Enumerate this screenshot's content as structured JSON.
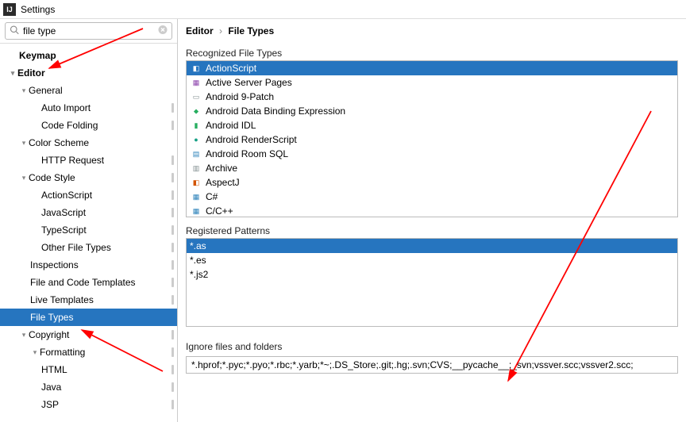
{
  "window": {
    "title": "Settings"
  },
  "search": {
    "value": "file type"
  },
  "tree": {
    "keymap": "Keymap",
    "editor": "Editor",
    "general": "General",
    "auto_import": "Auto Import",
    "code_folding": "Code Folding",
    "color_scheme": "Color Scheme",
    "http_request": "HTTP Request",
    "code_style": "Code Style",
    "actionscript": "ActionScript",
    "javascript": "JavaScript",
    "typescript": "TypeScript",
    "other_file_types": "Other File Types",
    "inspections": "Inspections",
    "file_code_templates": "File and Code Templates",
    "live_templates": "Live Templates",
    "file_types": "File Types",
    "copyright": "Copyright",
    "formatting": "Formatting",
    "html": "HTML",
    "java": "Java",
    "jsp": "JSP"
  },
  "breadcrumb": {
    "root": "Editor",
    "leaf": "File Types"
  },
  "labels": {
    "recognized": "Recognized File Types",
    "patterns": "Registered Patterns",
    "ignore": "Ignore files and folders"
  },
  "recognized": [
    {
      "label": "ActionScript",
      "selected": true,
      "iconColor": "c-red",
      "glyph": "◧"
    },
    {
      "label": "Active Server Pages",
      "iconColor": "c-purple",
      "glyph": "▦"
    },
    {
      "label": "Android 9-Patch",
      "iconColor": "c-grey",
      "glyph": "▭"
    },
    {
      "label": "Android Data Binding Expression",
      "iconColor": "c-green",
      "glyph": "⬥"
    },
    {
      "label": "Android IDL",
      "iconColor": "c-green",
      "glyph": "▮"
    },
    {
      "label": "Android RenderScript",
      "iconColor": "c-cyan",
      "glyph": "●"
    },
    {
      "label": "Android Room SQL",
      "iconColor": "c-blue",
      "glyph": "▤"
    },
    {
      "label": "Archive",
      "iconColor": "c-grey",
      "glyph": "▥"
    },
    {
      "label": "AspectJ",
      "iconColor": "c-orange",
      "glyph": "◧"
    },
    {
      "label": "C#",
      "iconColor": "c-blue",
      "glyph": "▦"
    },
    {
      "label": "C/C++",
      "iconColor": "c-blue",
      "glyph": "▦"
    }
  ],
  "patterns": [
    {
      "label": "*.as",
      "selected": true
    },
    {
      "label": "*.es"
    },
    {
      "label": "*.js2"
    }
  ],
  "ignore": {
    "value": "*.hprof;*.pyc;*.pyo;*.rbc;*.yarb;*~;.DS_Store;.git;.hg;.svn;CVS;__pycache__;_svn;vssver.scc;vssver2.scc;"
  }
}
